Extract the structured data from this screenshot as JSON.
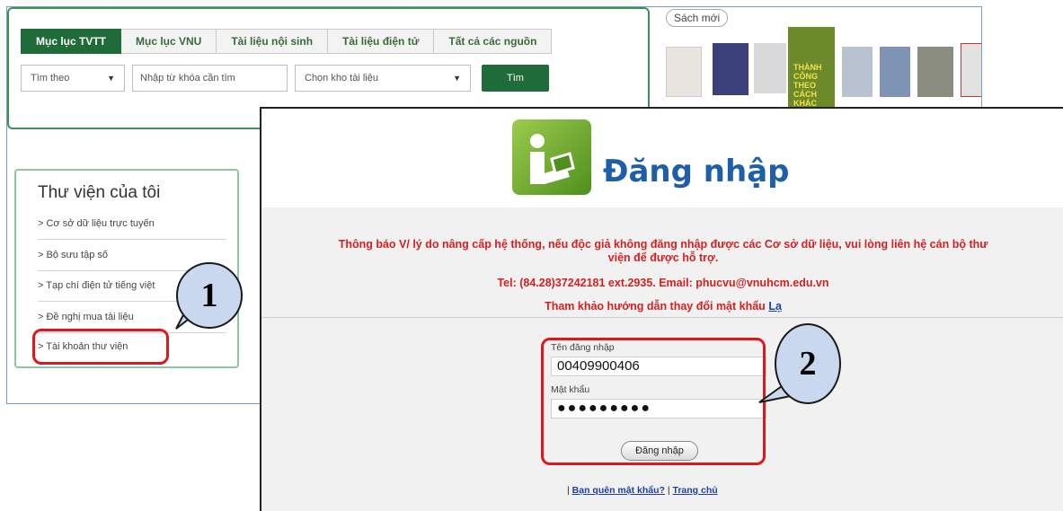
{
  "portal": {
    "tabs": [
      {
        "label": "Mục lục TVTT",
        "active": true
      },
      {
        "label": "Mục lục VNU",
        "active": false
      },
      {
        "label": "Tài liệu nội sinh",
        "active": false
      },
      {
        "label": "Tài liệu điện tử",
        "active": false
      },
      {
        "label": "Tất cả các nguồn",
        "active": false
      }
    ],
    "search_field_select": "Tìm theo",
    "search_input_placeholder": "Nhập từ khóa cần tìm",
    "collection_select": "Chọn kho tài liệu",
    "search_button": "Tìm",
    "new_books_label": "Sách mới",
    "featured_book_text": "THÀNH CÔNG THEO CÁCH KHÁC",
    "sidebar": {
      "title": "Thư viện của tôi",
      "items": [
        "> Cơ sở dữ liệu trực tuyến",
        "> Bộ sưu tập số",
        "> Tạp chí điện tử tiếng việt",
        "> Đề nghị mua tài liệu",
        "> Tài khoản thư viện"
      ]
    }
  },
  "login": {
    "title": "Đăng nhập",
    "notice_line1": "Thông báo V/ lý do nâng cấp hệ thống, nếu độc giả không đăng nhập được các Cơ sở dữ liệu, vui lòng liên hệ cán bộ thư",
    "notice_line2": "viện để được hỗ trợ.",
    "contact": "Tel: (84.28)37242181 ext.2935. Email: phucvu@vnuhcm.edu.vn",
    "guide_text": "Tham khảo hướng dẫn thay đổi mật khẩu",
    "guide_link": "Lạ",
    "username_label": "Tên đăng nhập",
    "username_value": "00409900406",
    "password_label": "Mật khẩu",
    "password_value": "●●●●●●●●●",
    "login_button": "Đăng nhập",
    "forgot_link": "Bạn quên mật khẩu?",
    "separator": "|",
    "home_link": "Trang chủ"
  },
  "annotations": {
    "callout_1": "1",
    "callout_2": "2",
    "highlight_color": "#e0161d",
    "callout_fill": "#c9d8ef"
  }
}
